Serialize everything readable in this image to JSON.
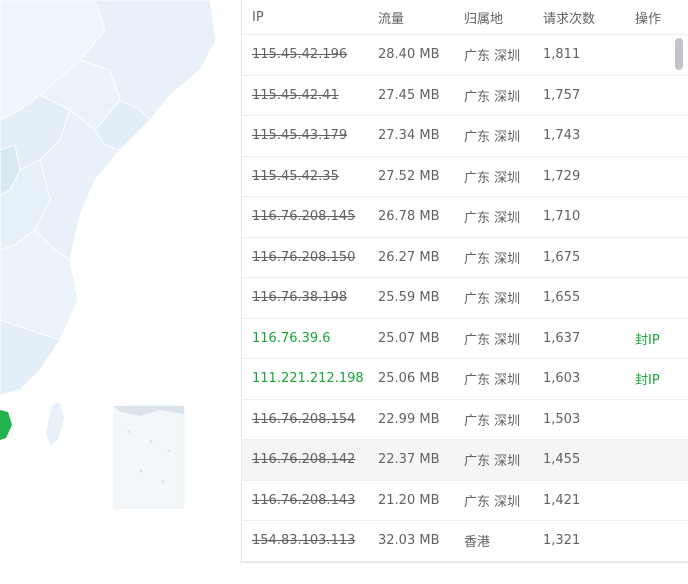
{
  "table": {
    "headers": {
      "ip": "IP",
      "flow": "流量",
      "location": "归属地",
      "requests": "请求次数",
      "action": "操作"
    },
    "rows": [
      {
        "ip": "115.45.42.196",
        "flow": "28.40 MB",
        "location": "广东 深圳",
        "requests": "1,811",
        "action": "",
        "blocked": true
      },
      {
        "ip": "115.45.42.41",
        "flow": "27.45 MB",
        "location": "广东 深圳",
        "requests": "1,757",
        "action": "",
        "blocked": true
      },
      {
        "ip": "115.45.43.179",
        "flow": "27.34 MB",
        "location": "广东 深圳",
        "requests": "1,743",
        "action": "",
        "blocked": true
      },
      {
        "ip": "115.45.42.35",
        "flow": "27.52 MB",
        "location": "广东 深圳",
        "requests": "1,729",
        "action": "",
        "blocked": true
      },
      {
        "ip": "116.76.208.145",
        "flow": "26.78 MB",
        "location": "广东 深圳",
        "requests": "1,710",
        "action": "",
        "blocked": true
      },
      {
        "ip": "116.76.208.150",
        "flow": "26.27 MB",
        "location": "广东 深圳",
        "requests": "1,675",
        "action": "",
        "blocked": true
      },
      {
        "ip": "116.76.38.198",
        "flow": "25.59 MB",
        "location": "广东 深圳",
        "requests": "1,655",
        "action": "",
        "blocked": true
      },
      {
        "ip": "116.76.39.6",
        "flow": "25.07 MB",
        "location": "广东 深圳",
        "requests": "1,637",
        "action": "封IP",
        "blocked": false
      },
      {
        "ip": "111.221.212.198",
        "flow": "25.06 MB",
        "location": "广东 深圳",
        "requests": "1,603",
        "action": "封IP",
        "blocked": false
      },
      {
        "ip": "116.76.208.154",
        "flow": "22.99 MB",
        "location": "广东 深圳",
        "requests": "1,503",
        "action": "",
        "blocked": true
      },
      {
        "ip": "116.76.208.142",
        "flow": "22.37 MB",
        "location": "广东 深圳",
        "requests": "1,455",
        "action": "",
        "blocked": true
      },
      {
        "ip": "116.76.208.143",
        "flow": "21.20 MB",
        "location": "广东 深圳",
        "requests": "1,421",
        "action": "",
        "blocked": true
      },
      {
        "ip": "154.83.103.113",
        "flow": "32.03 MB",
        "location": "香港",
        "requests": "1,321",
        "action": "",
        "blocked": true
      }
    ]
  },
  "colors": {
    "active_ip": "#1aa33a",
    "map_land": "#e8f1f9",
    "map_highlight": "#22b24c"
  }
}
